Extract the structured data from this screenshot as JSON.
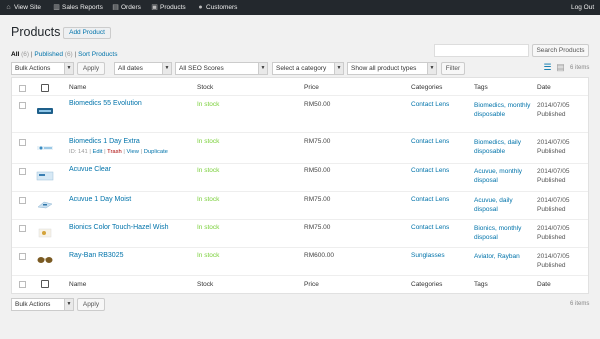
{
  "topbar": {
    "view_site": "View Site",
    "sales_reports": "Sales Reports",
    "orders": "Orders",
    "products": "Products",
    "customers": "Customers",
    "logout": "Log Out"
  },
  "page": {
    "title": "Products",
    "add_button": "Add Product"
  },
  "filters": {
    "all_label": "All",
    "all_count": "(6)",
    "published_label": "Published",
    "published_count": "(6)",
    "sort_label": "Sort Products",
    "sep": "|"
  },
  "search": {
    "value": "",
    "button": "Search Products"
  },
  "toolbar": {
    "bulk_actions": "Bulk Actions",
    "apply": "Apply",
    "dates": "All dates",
    "seo": "All SEO Scores",
    "category": "Select a category",
    "product_type": "Show all product types",
    "filter": "Filter",
    "items": "6 items"
  },
  "columns": {
    "name": "Name",
    "stock": "Stock",
    "price": "Price",
    "categories": "Categories",
    "tags": "Tags",
    "date": "Date"
  },
  "rows": [
    {
      "name": "Biomedics 55 Evolution",
      "stock": "In stock",
      "price": "RM50.00",
      "category": "Contact Lens",
      "tags": "Biomedics, monthly disposable",
      "date": "2014/07/05",
      "status": "Published"
    },
    {
      "name": "Biomedics 1 Day Extra",
      "stock": "In stock",
      "price": "RM75.00",
      "category": "Contact Lens",
      "tags": "Biomedics, daily disposable",
      "date": "2014/07/05",
      "status": "Published"
    },
    {
      "name": "Acuvue Clear",
      "stock": "In stock",
      "price": "RM50.00",
      "category": "Contact Lens",
      "tags": "Acuvue, monthly disposal",
      "date": "2014/07/05",
      "status": "Published"
    },
    {
      "name": "Acuvue 1 Day Moist",
      "stock": "In stock",
      "price": "RM75.00",
      "category": "Contact Lens",
      "tags": "Acuvue, daily disposal",
      "date": "2014/07/05",
      "status": "Published"
    },
    {
      "name": "Bionics Color Touch-Hazel Wish",
      "stock": "In stock",
      "price": "RM75.00",
      "category": "Contact Lens",
      "tags": "Bionics, monthly disposal",
      "date": "2014/07/05",
      "status": "Published"
    },
    {
      "name": "Ray-Ban RB3025",
      "stock": "In stock",
      "price": "RM600.00",
      "category": "Sunglasses",
      "tags": "Aviator, Rayban",
      "date": "2014/07/05",
      "status": "Published"
    }
  ],
  "row_actions": {
    "id": "ID: 141",
    "sep": "|",
    "edit": "Edit",
    "trash": "Trash",
    "view": "View",
    "duplicate": "Duplicate"
  },
  "icons": {
    "view_site": "home-icon",
    "sales_reports": "chart-icon",
    "orders": "cart-icon",
    "products": "box-icon",
    "customers": "users-icon",
    "list_view": "list-view-icon",
    "excerpt_view": "excerpt-view-icon",
    "image_column": "image-icon"
  },
  "colors": {
    "admin_bar": "#23282d",
    "link": "#0073aa",
    "in_stock": "#7ad03a"
  }
}
